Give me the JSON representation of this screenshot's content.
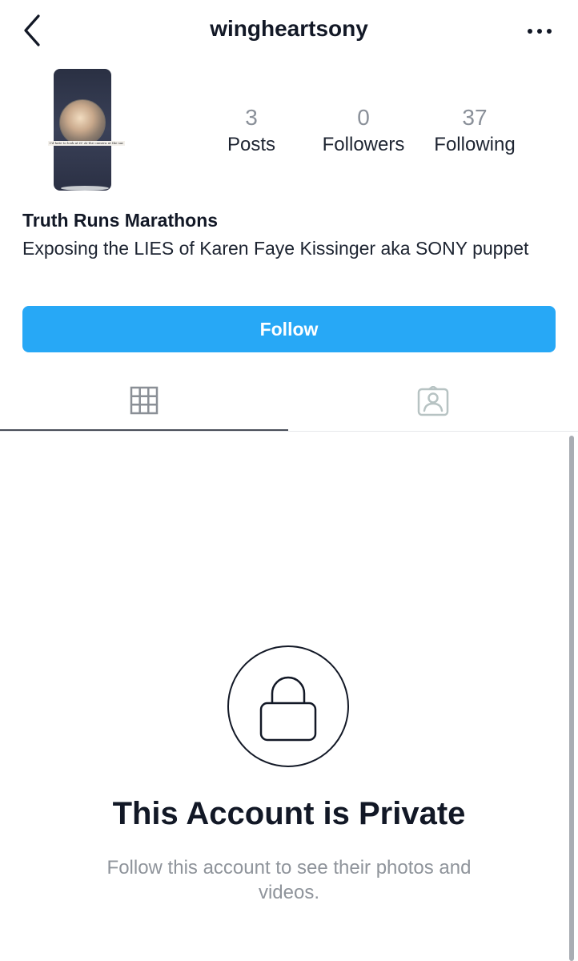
{
  "header": {
    "back_icon": "chevron-left-icon",
    "username": "wingheartsony",
    "more_icon": "more-horizontal-icon"
  },
  "profile": {
    "avatar": {
      "caption_text": "I'd hate to look at it! At the camera at the same time"
    },
    "stats": [
      {
        "value": "3",
        "label": "Posts"
      },
      {
        "value": "0",
        "label": "Followers"
      },
      {
        "value": "37",
        "label": "Following"
      }
    ],
    "display_name": "Truth Runs Marathons",
    "bio": "Exposing the LIES of Karen Faye Kissinger aka SONY puppet"
  },
  "follow_button": {
    "label": "Follow",
    "color": "#27a8f6"
  },
  "tabs": [
    {
      "icon": "grid-icon",
      "active": true
    },
    {
      "icon": "tagged-person-icon",
      "active": false
    }
  ],
  "private_notice": {
    "icon": "lock-icon",
    "title": "This Account is Private",
    "subtitle": "Follow this account to see their photos and videos."
  },
  "colors": {
    "accent": "#27a8f6",
    "text_primary": "#121826",
    "text_muted": "#8f949b",
    "divider": "#e6e8eb"
  }
}
